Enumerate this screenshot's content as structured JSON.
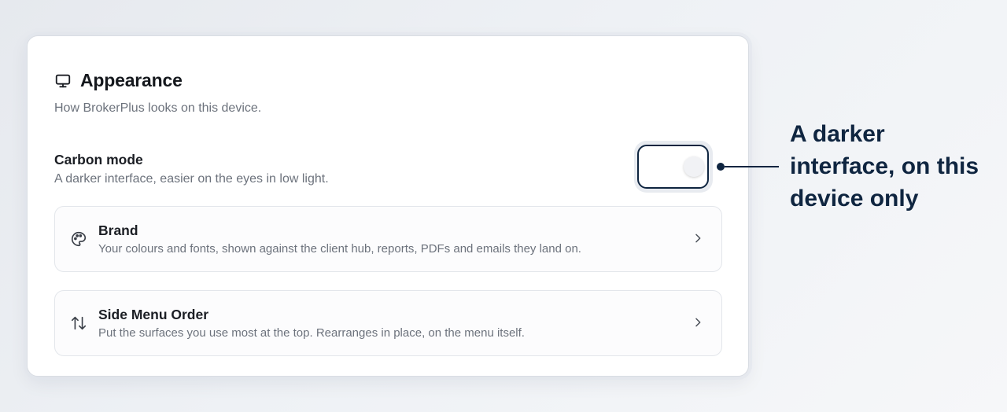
{
  "appearance": {
    "title": "Appearance",
    "description": "How BrokerPlus looks on this device.",
    "icon": "monitor-icon"
  },
  "carbon_mode": {
    "title": "Carbon mode",
    "description": "A darker interface, easier on the eyes in low light.",
    "enabled": false
  },
  "brand": {
    "title": "Brand",
    "description": "Your colours and fonts, shown against the client hub, reports, PDFs and emails they land on.",
    "icon": "palette-icon"
  },
  "side_menu_order": {
    "title": "Side Menu Order",
    "description": "Put the surfaces you use most at the top. Rearranges in place, on the menu itself.",
    "icon": "sort-arrows-icon"
  },
  "annotation": {
    "text": "A darker interface, on this device only"
  },
  "colors": {
    "accent": "#0f2540",
    "muted_text": "#6c727c",
    "card_border": "#d9dde3"
  }
}
